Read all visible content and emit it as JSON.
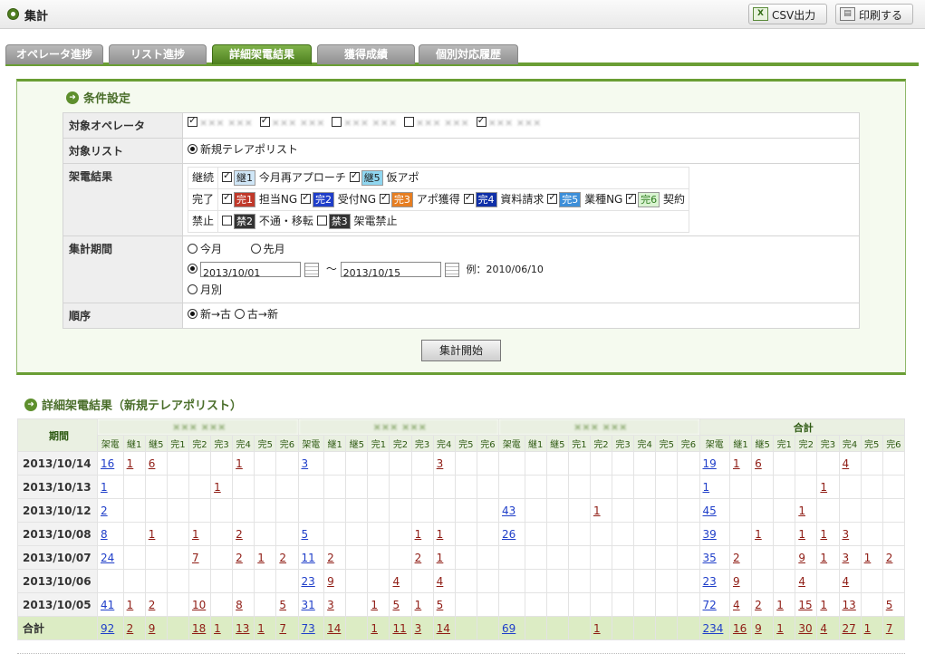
{
  "header": {
    "title": "集計",
    "csv_label": "CSV出力",
    "print_label": "印刷する"
  },
  "tabs": [
    "オペレータ進捗",
    "リスト進捗",
    "詳細架電結果",
    "獲得成績",
    "個別対応履歴"
  ],
  "conditions": {
    "title": "条件設定",
    "operators_label": "対象オペレータ",
    "operators": [
      {
        "name": "××× ×××",
        "checked": true
      },
      {
        "name": "××× ×××",
        "checked": true
      },
      {
        "name": "××× ×××",
        "checked": false
      },
      {
        "name": "××× ×××",
        "checked": false
      },
      {
        "name": "××× ×××",
        "checked": true
      }
    ],
    "list_label": "対象リスト",
    "list_value": "新規テレアポリスト",
    "result_label": "架電結果",
    "groups": {
      "keizoku": "継続",
      "kanryo": "完了",
      "kinshi": "禁止"
    },
    "results_keizoku": [
      {
        "badge": "継1",
        "text": "今月再アプローチ"
      },
      {
        "badge": "継5",
        "text": "仮アポ"
      }
    ],
    "results_kanryo": [
      {
        "badge": "完1",
        "text": "担当NG"
      },
      {
        "badge": "完2",
        "text": "受付NG"
      },
      {
        "badge": "完3",
        "text": "アポ獲得"
      },
      {
        "badge": "完4",
        "text": "資料請求"
      },
      {
        "badge": "完5",
        "text": "業種NG"
      },
      {
        "badge": "完6",
        "text": "契約"
      }
    ],
    "results_kinshi": [
      {
        "badge": "禁2",
        "text": "不通・移転"
      },
      {
        "badge": "禁3",
        "text": "架電禁止"
      }
    ],
    "period_label": "集計期間",
    "this_month": "今月",
    "last_month": "先月",
    "date_from": "2013/10/01",
    "tilde": "～",
    "date_to": "2013/10/15",
    "example": "例：2010/06/10",
    "monthly": "月別",
    "order_label": "順序",
    "order_new": "新→古",
    "order_old": "古→新",
    "start_button": "集計開始"
  },
  "results": {
    "title": "詳細架電結果（新規テレアポリスト）",
    "period_header": "期間",
    "group_headers": [
      "××× ×××",
      "××× ×××",
      "××× ×××",
      "合計"
    ],
    "sub_headers": [
      "架電",
      "継1",
      "継5",
      "完1",
      "完2",
      "完3",
      "完4",
      "完5",
      "完6"
    ],
    "rows": [
      {
        "date": "2013/10/14",
        "cells": [
          [
            "16",
            "1",
            "6",
            "",
            "",
            "",
            "1",
            "",
            ""
          ],
          [
            "3",
            "",
            "",
            "",
            "",
            "",
            "3",
            "",
            ""
          ],
          [
            "",
            "",
            "",
            "",
            "",
            "",
            "",
            "",
            ""
          ],
          [
            "19",
            "1",
            "6",
            "",
            "",
            "",
            "4",
            "",
            ""
          ]
        ]
      },
      {
        "date": "2013/10/13",
        "cells": [
          [
            "1",
            "",
            "",
            "",
            "",
            "1",
            "",
            "",
            ""
          ],
          [
            "",
            "",
            "",
            "",
            "",
            "",
            "",
            "",
            ""
          ],
          [
            "",
            "",
            "",
            "",
            "",
            "",
            "",
            "",
            ""
          ],
          [
            "1",
            "",
            "",
            "",
            "",
            "1",
            "",
            "",
            ""
          ]
        ]
      },
      {
        "date": "2013/10/12",
        "cells": [
          [
            "2",
            "",
            "",
            "",
            "",
            "",
            "",
            "",
            ""
          ],
          [
            "",
            "",
            "",
            "",
            "",
            "",
            "",
            "",
            ""
          ],
          [
            "43",
            "",
            "",
            "",
            "1",
            "",
            "",
            "",
            ""
          ],
          [
            "45",
            "",
            "",
            "",
            "1",
            "",
            "",
            "",
            ""
          ]
        ]
      },
      {
        "date": "2013/10/08",
        "cells": [
          [
            "8",
            "",
            "1",
            "",
            "1",
            "",
            "2",
            "",
            ""
          ],
          [
            "5",
            "",
            "",
            "",
            "",
            "1",
            "1",
            "",
            ""
          ],
          [
            "26",
            "",
            "",
            "",
            "",
            "",
            "",
            "",
            ""
          ],
          [
            "39",
            "",
            "1",
            "",
            "1",
            "1",
            "3",
            "",
            ""
          ]
        ]
      },
      {
        "date": "2013/10/07",
        "cells": [
          [
            "24",
            "",
            "",
            "",
            "7",
            "",
            "2",
            "1",
            "2"
          ],
          [
            "11",
            "2",
            "",
            "",
            "",
            "2",
            "1",
            "",
            ""
          ],
          [
            "",
            "",
            "",
            "",
            "",
            "",
            "",
            "",
            ""
          ],
          [
            "35",
            "2",
            "",
            "",
            "9",
            "1",
            "3",
            "1",
            "2"
          ]
        ]
      },
      {
        "date": "2013/10/06",
        "cells": [
          [
            "",
            "",
            "",
            "",
            "",
            "",
            "",
            "",
            ""
          ],
          [
            "23",
            "9",
            "",
            "",
            "4",
            "",
            "4",
            "",
            ""
          ],
          [
            "",
            "",
            "",
            "",
            "",
            "",
            "",
            "",
            ""
          ],
          [
            "23",
            "9",
            "",
            "",
            "4",
            "",
            "4",
            "",
            ""
          ]
        ]
      },
      {
        "date": "2013/10/05",
        "cells": [
          [
            "41",
            "1",
            "2",
            "",
            "10",
            "",
            "8",
            "",
            "5"
          ],
          [
            "31",
            "3",
            "",
            "1",
            "5",
            "1",
            "5",
            "",
            ""
          ],
          [
            "",
            "",
            "",
            "",
            "",
            "",
            "",
            "",
            ""
          ],
          [
            "72",
            "4",
            "2",
            "1",
            "15",
            "1",
            "13",
            "",
            "5"
          ]
        ]
      }
    ],
    "total_label": "合計",
    "totals": [
      [
        "92",
        "2",
        "9",
        "",
        "18",
        "1",
        "13",
        "1",
        "7"
      ],
      [
        "73",
        "14",
        "",
        "1",
        "11",
        "3",
        "14",
        "",
        ""
      ],
      [
        "69",
        "",
        "",
        "",
        "1",
        "",
        "",
        "",
        ""
      ],
      [
        "234",
        "16",
        "9",
        "1",
        "30",
        "4",
        "27",
        "1",
        "7"
      ]
    ]
  }
}
